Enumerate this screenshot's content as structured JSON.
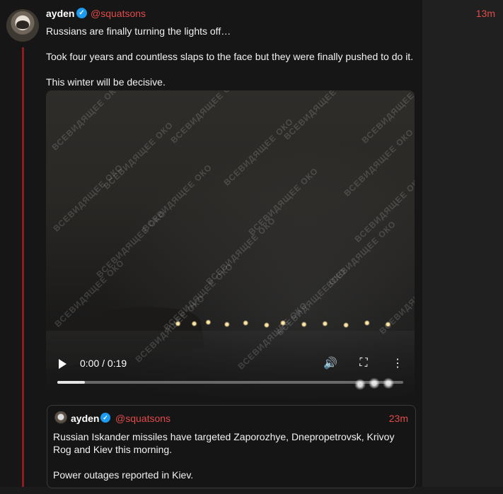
{
  "post": {
    "author_name": "ayden",
    "verified_mark": "✓",
    "handle": "@squatsons",
    "time": "13m",
    "lines": [
      "Russians are finally turning the lights off…",
      "Took four years and countless slaps to the face but they were finally pushed to do it.",
      "This winter will be decisive."
    ]
  },
  "video": {
    "watermark_text": "ВСЕВИДЯЩЕЕ ОКО",
    "time_display": "0:00 / 0:19",
    "progress": 0.08
  },
  "quote": {
    "author_name": "ayden",
    "verified_mark": "✓",
    "handle": "@squatsons",
    "time": "23m",
    "lines": [
      "Russian Iskander missiles have targeted Zaporozhye, Dnepropetrovsk, Krivoy Rog and Kiev this morning.",
      "Power outages reported in Kiev."
    ]
  },
  "colors": {
    "handle": "#e04b4b",
    "verified": "#1d9bf0",
    "thread_line": "#8c1d1f"
  }
}
